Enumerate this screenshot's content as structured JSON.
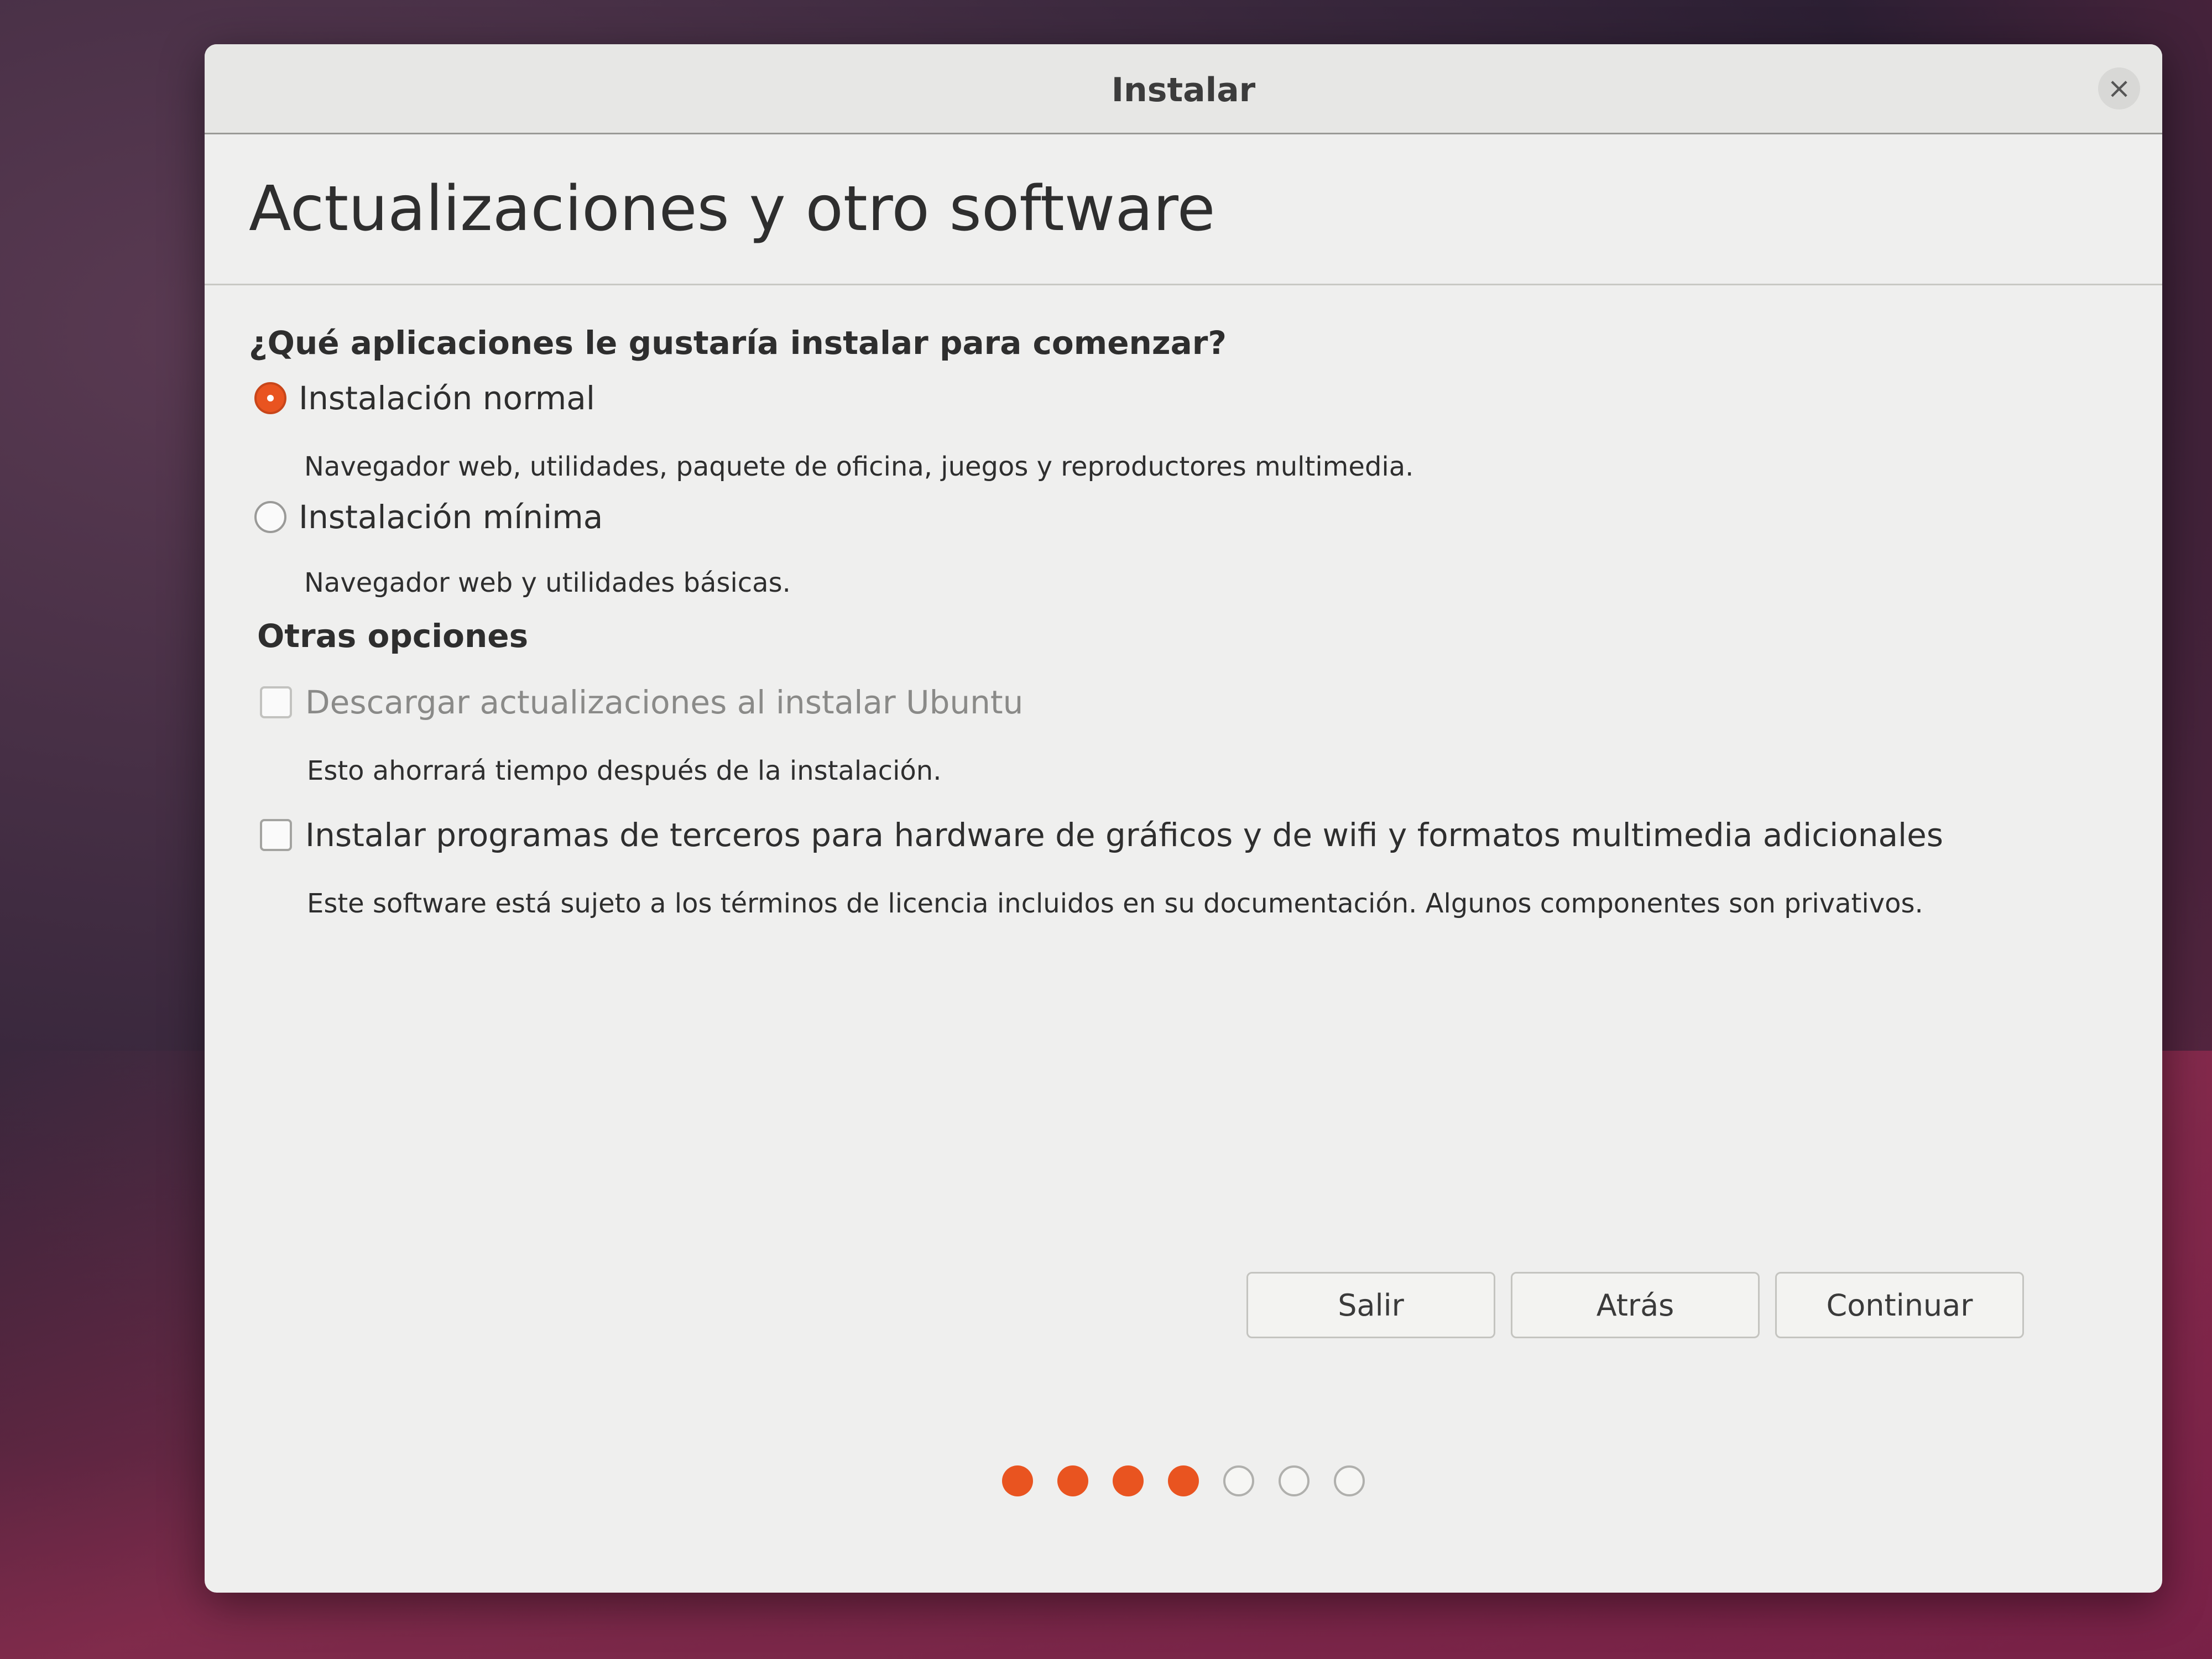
{
  "window": {
    "title": "Instalar",
    "close_glyph": "×"
  },
  "header": {
    "title": "Actualizaciones y otro software"
  },
  "question": "¿Qué aplicaciones le gustaría instalar para comenzar?",
  "install_options": [
    {
      "label": "Instalación normal",
      "description": "Navegador web, utilidades, paquete de oficina, juegos y reproductores multimedia.",
      "selected": true
    },
    {
      "label": "Instalación mínima",
      "description": "Navegador web y utilidades básicas.",
      "selected": false
    }
  ],
  "other_options": {
    "title": "Otras opciones",
    "items": [
      {
        "label": "Descargar actualizaciones al instalar Ubuntu",
        "description": "Esto ahorrará tiempo después de la instalación.",
        "checked": false,
        "enabled": false
      },
      {
        "label": "Instalar programas de terceros para hardware de gráficos y de wifi y formatos multimedia adicionales",
        "description": "Este software está sujeto a los términos de licencia incluidos en su documentación. Algunos componentes son privativos.",
        "checked": false,
        "enabled": true
      }
    ]
  },
  "buttons": {
    "quit": "Salir",
    "back": "Atrás",
    "continue": "Continuar"
  },
  "progress": {
    "total_steps": 7,
    "completed_steps": 4
  },
  "colors": {
    "accent": "#e95420",
    "window_bg": "#efefee"
  }
}
